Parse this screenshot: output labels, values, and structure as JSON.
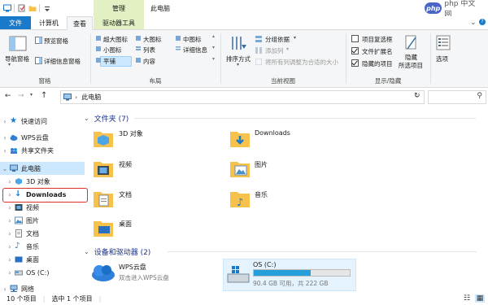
{
  "window": {
    "title": "此电脑",
    "manage_band": "管理"
  },
  "watermark": "php 中文网",
  "tabs": {
    "file": "文件",
    "computer": "计算机",
    "view": "查看",
    "drive_tools": "驱动器工具"
  },
  "ribbon": {
    "panes": {
      "nav_pane": "导航窗格",
      "preview_pane": "预览窗格",
      "details_pane": "详细信息窗格",
      "group_label": "窗格"
    },
    "layout": {
      "xl_icons": "超大图标",
      "large_icons": "大图标",
      "medium_icons": "中图标",
      "small_icons": "小图标",
      "list": "列表",
      "details": "详细信息",
      "tiles": "平铺",
      "content": "内容",
      "group_label": "布局"
    },
    "current_view": {
      "sort_by": "排序方式",
      "group_by": "分组依据",
      "add_column": "添加列",
      "fit_columns": "将所有列调整为合适的大小",
      "group_label": "当前视图"
    },
    "show_hide": {
      "item_checkboxes": "项目复选框",
      "item_checkboxes_checked": false,
      "file_extensions": "文件扩展名",
      "file_extensions_checked": true,
      "hidden_items": "隐藏的项目",
      "hidden_items_checked": true,
      "hide_selected_line1": "隐藏",
      "hide_selected_line2": "所选项目",
      "group_label": "显示/隐藏"
    },
    "options": "选项"
  },
  "address": {
    "path": "此电脑"
  },
  "nav": {
    "items": [
      {
        "label": "快速访问"
      },
      {
        "label": "WPS云盘"
      },
      {
        "label": "共享文件夹"
      },
      {
        "label": "此电脑"
      },
      {
        "label": "3D 对象"
      },
      {
        "label": "Downloads"
      },
      {
        "label": "视频"
      },
      {
        "label": "图片"
      },
      {
        "label": "文档"
      },
      {
        "label": "音乐"
      },
      {
        "label": "桌面"
      },
      {
        "label": "OS (C:)"
      },
      {
        "label": "网络"
      }
    ]
  },
  "content": {
    "folders_title": "文件夹 (7)",
    "folders": [
      {
        "name": "3D 对象"
      },
      {
        "name": "Downloads"
      },
      {
        "name": "视频"
      },
      {
        "name": "图片"
      },
      {
        "name": "文档"
      },
      {
        "name": "音乐"
      },
      {
        "name": "桌面"
      }
    ],
    "devices_title": "设备和驱动器 (2)",
    "wps": {
      "name": "WPS云盘",
      "sub": "双击进入WPS云盘"
    },
    "drive": {
      "name": "OS (C:)",
      "free": "90.4 GB 可用，共 222 GB",
      "used_fraction": 0.59
    }
  },
  "status": {
    "count": "10 个项目",
    "selected": "选中 1 个项目"
  },
  "colors": {
    "accent": "#1979ca",
    "selection": "#cce8ff",
    "highlight": "#e0302a",
    "folder": "#f6c24c",
    "drive_bar": "#26a0da"
  }
}
